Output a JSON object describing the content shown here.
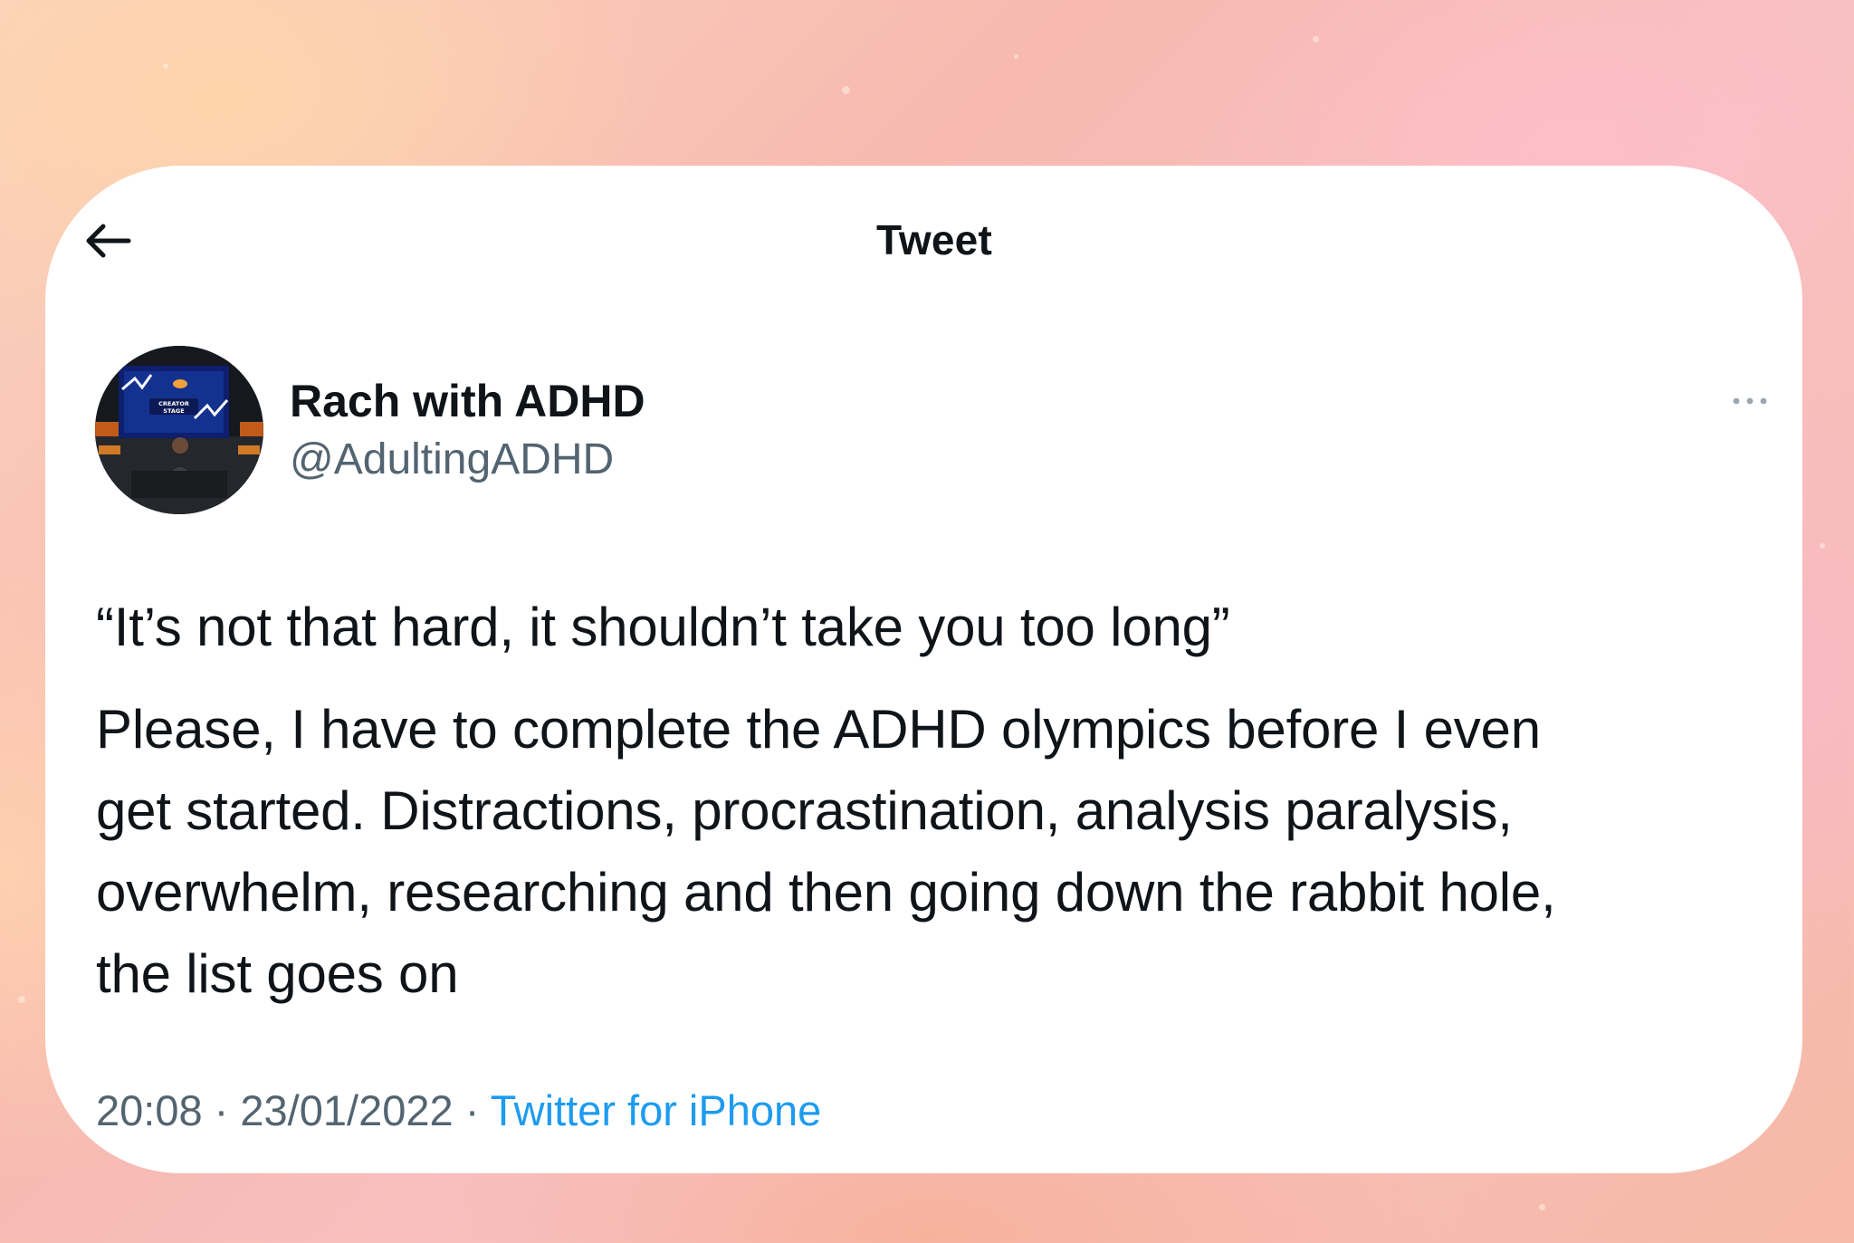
{
  "header": {
    "title": "Tweet"
  },
  "author": {
    "name": "Rach with ADHD",
    "handle": "@AdultingADHD",
    "avatar_screen_text": "CREATOR STAGE"
  },
  "tweet": {
    "lines": [
      "“It’s not that hard, it shouldn’t take you too long”",
      "Please, I have to complete the ADHD olympics before I even",
      "get started. Distractions, procrastination, analysis paralysis,",
      "overwhelm, researching and then going down the rabbit hole,",
      "the list goes on"
    ]
  },
  "meta": {
    "time": "20:08",
    "separator": " · ",
    "date": "23/01/2022",
    "source": "Twitter for iPhone"
  },
  "icons": {
    "back": "arrow-left-icon",
    "more": "more-dots-icon"
  },
  "colors": {
    "text_primary": "#0f1419",
    "text_secondary": "#536471",
    "link": "#1d9bf0",
    "card": "#ffffff"
  }
}
